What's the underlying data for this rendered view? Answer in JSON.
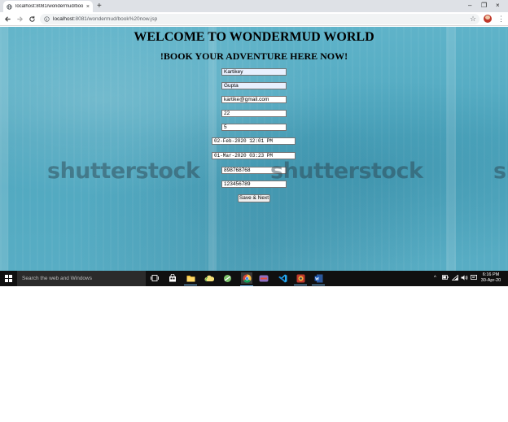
{
  "browser": {
    "tab_title": "localhost:8081/wondermud/boo",
    "tab_close": "×",
    "new_tab": "+",
    "window_controls": [
      "–",
      "❐",
      "×"
    ],
    "url_host": "localhost",
    "url_path": ":8081/wondermud/book%20now.jsp"
  },
  "page": {
    "title": "WELCOME TO WONDERMUD WORLD",
    "subtitle": "!BOOK YOUR ADVENTURE HERE NOW!",
    "fields": {
      "first_name": "Kartikey",
      "last_name": "Gupta",
      "email": "kartike@gmail.com",
      "age": "22",
      "count": "5",
      "start_datetime": "02-Feb-2020 12:01 PM",
      "end_datetime": "01-Mar-2020 03:23 PM",
      "phone": "898768768",
      "code": "123456789"
    },
    "save_button": "Save & Next",
    "watermark": "shutterstock"
  },
  "taskbar": {
    "search_placeholder": "Search the web and Windows",
    "tray_caret": "^",
    "time": "6:16 PM",
    "date": "30-Apr-20"
  },
  "colors": {
    "background": "#4fa7bf",
    "taskbar": "#101010",
    "accent": "#76b9ed"
  }
}
